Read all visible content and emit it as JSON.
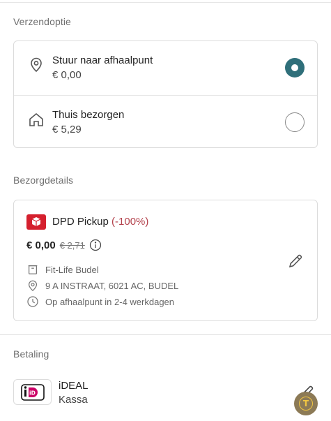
{
  "shipping": {
    "section_title": "Verzendoptie",
    "options": [
      {
        "name": "Stuur naar afhaalpunt",
        "price": "€ 0,00",
        "icon": "map-pin-icon",
        "selected": true
      },
      {
        "name": "Thuis bezorgen",
        "price": "€ 5,29",
        "icon": "house-icon",
        "selected": false
      }
    ]
  },
  "delivery": {
    "section_title": "Bezorgdetails",
    "carrier_name": "DPD Pickup",
    "discount": "(-100%)",
    "price_now": "€ 0,00",
    "price_old": "€ 2,71",
    "details": [
      {
        "icon": "store-icon",
        "text": "Fit-Life Budel"
      },
      {
        "icon": "map-pin-icon",
        "text": "9 A INSTRAAT, 6021 AC, BUDEL"
      },
      {
        "icon": "clock-icon",
        "text": "Op afhaalpunt in 2-4 werkdagen"
      }
    ]
  },
  "payment": {
    "section_title": "Betaling",
    "method_name": "iDEAL",
    "method_sub": "Kassa",
    "logo_text": "iD"
  },
  "colors": {
    "accent": "#2f6f7a",
    "discount": "#b3414b",
    "dpd_red": "#d5202e",
    "ideal_pink": "#cc0066"
  },
  "float_button": {
    "glyph": "T"
  }
}
